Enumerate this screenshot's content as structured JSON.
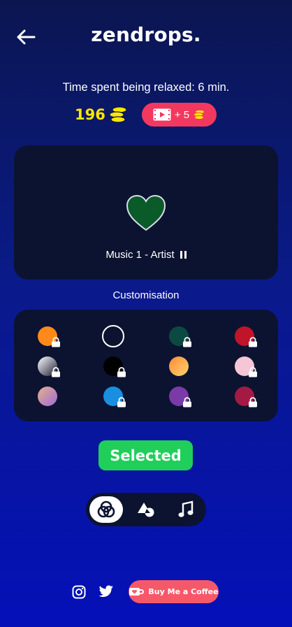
{
  "header": {
    "brand": "zendrops.",
    "back_icon": "arrow-left-icon"
  },
  "stats": {
    "relax_text": "Time spent being relaxed: 6 min.",
    "coins": "196",
    "ad_reward": "+ 5"
  },
  "player": {
    "track": "Music 1 - Artist",
    "heart_color": "#0a5a2a",
    "state": "playing"
  },
  "customisation": {
    "title": "Customisation",
    "swatches": [
      {
        "color": "#ff8a1a",
        "locked": true
      },
      {
        "color": "outline-white",
        "locked": false,
        "selected": true
      },
      {
        "color": "#0b4a42",
        "locked": true
      },
      {
        "color": "#c0142a",
        "locked": true
      },
      {
        "color": "gradient-white-black",
        "locked": true
      },
      {
        "color": "#000000",
        "locked": true
      },
      {
        "color": "gradient-orange-yellow",
        "locked": false
      },
      {
        "color": "#f4c6d6",
        "locked": true
      },
      {
        "color": "gradient-tan-purple",
        "locked": false
      },
      {
        "color": "#1a8fe0",
        "locked": true
      },
      {
        "color": "#7a3aa8",
        "locked": true
      },
      {
        "color": "#a31a45",
        "locked": true
      }
    ]
  },
  "actions": {
    "selected_label": "Selected"
  },
  "tabs": [
    {
      "name": "colors-icon",
      "active": true
    },
    {
      "name": "shapes-icon",
      "active": false
    },
    {
      "name": "music-note-icon",
      "active": false
    }
  ],
  "footer": {
    "coffee_label": "Buy Me a Coffee",
    "accent": "#f6586a"
  }
}
